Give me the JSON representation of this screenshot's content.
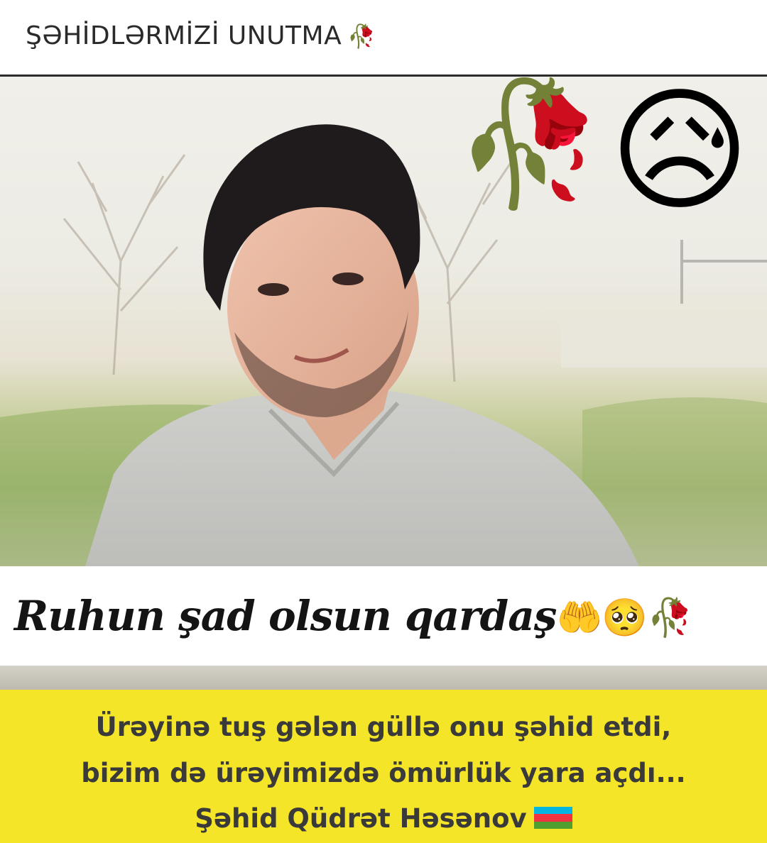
{
  "header": {
    "title": "ŞƏHİDLƏRMİZİ UNUTMA",
    "rose_emoji": "🥀"
  },
  "photo": {
    "rose_emoji": "🥀",
    "sad_emoji": "😥"
  },
  "caption": {
    "text": "Ruhun şad olsun qardaş",
    "emojis": [
      "🤲",
      "🥺",
      "🥀"
    ]
  },
  "banner": {
    "line1": "Ürəyinə tuş gələn güllə onu şəhid etdi,",
    "line2": "bizim də ürəyimizdə ömürlük yara açdı...",
    "line3": "Şəhid Qüdrət Həsənov",
    "flag_colors": [
      "#00b5e2",
      "#ef3340",
      "#509e2f"
    ],
    "background": "#f5e528"
  }
}
